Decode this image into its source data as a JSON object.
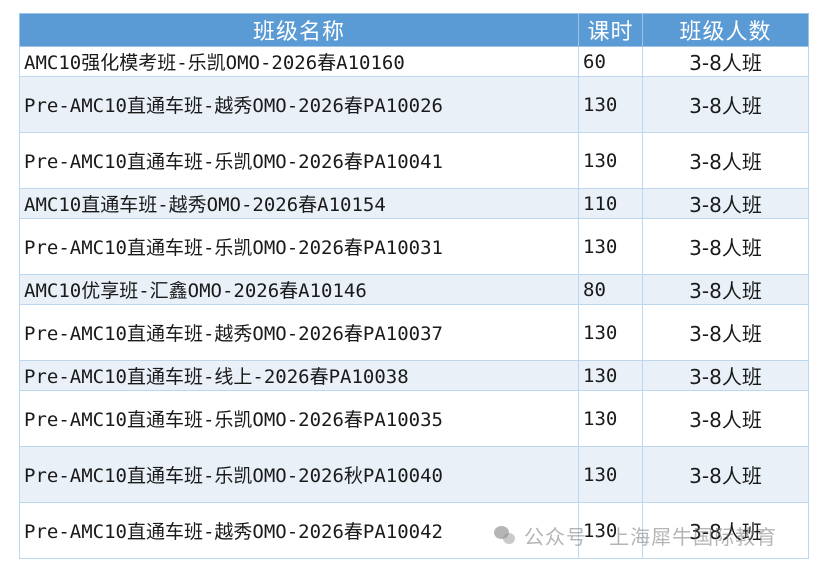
{
  "header": {
    "name": "班级名称",
    "hours": "课时",
    "size": "班级人数"
  },
  "rows": [
    {
      "name": "AMC10强化模考班-乐凯OMO-2026春A10160",
      "hours": "60",
      "size": "3-8人班"
    },
    {
      "name": "Pre-AMC10直通车班-越秀OMO-2026春PA10026",
      "hours": "130",
      "size": "3-8人班"
    },
    {
      "name": "Pre-AMC10直通车班-乐凯OMO-2026春PA10041",
      "hours": "130",
      "size": "3-8人班"
    },
    {
      "name": "AMC10直通车班-越秀OMO-2026春A10154",
      "hours": "110",
      "size": "3-8人班"
    },
    {
      "name": "Pre-AMC10直通车班-乐凯OMO-2026春PA10031",
      "hours": "130",
      "size": "3-8人班"
    },
    {
      "name": "AMC10优享班-汇鑫OMO-2026春A10146",
      "hours": "80",
      "size": "3-8人班"
    },
    {
      "name": "Pre-AMC10直通车班-越秀OMO-2026春PA10037",
      "hours": "130",
      "size": "3-8人班"
    },
    {
      "name": "Pre-AMC10直通车班-线上-2026春PA10038",
      "hours": "130",
      "size": "3-8人班"
    },
    {
      "name": "Pre-AMC10直通车班-乐凯OMO-2026春PA10035",
      "hours": "130",
      "size": "3-8人班"
    },
    {
      "name": "Pre-AMC10直通车班-乐凯OMO-2026秋PA10040",
      "hours": "130",
      "size": "3-8人班"
    },
    {
      "name": "Pre-AMC10直通车班-越秀OMO-2026春PA10042",
      "hours": "130",
      "size": "3-8人班"
    }
  ],
  "watermark": {
    "text": "公众号 · 上海犀牛国际教育",
    "icon": "wechat-icon"
  }
}
